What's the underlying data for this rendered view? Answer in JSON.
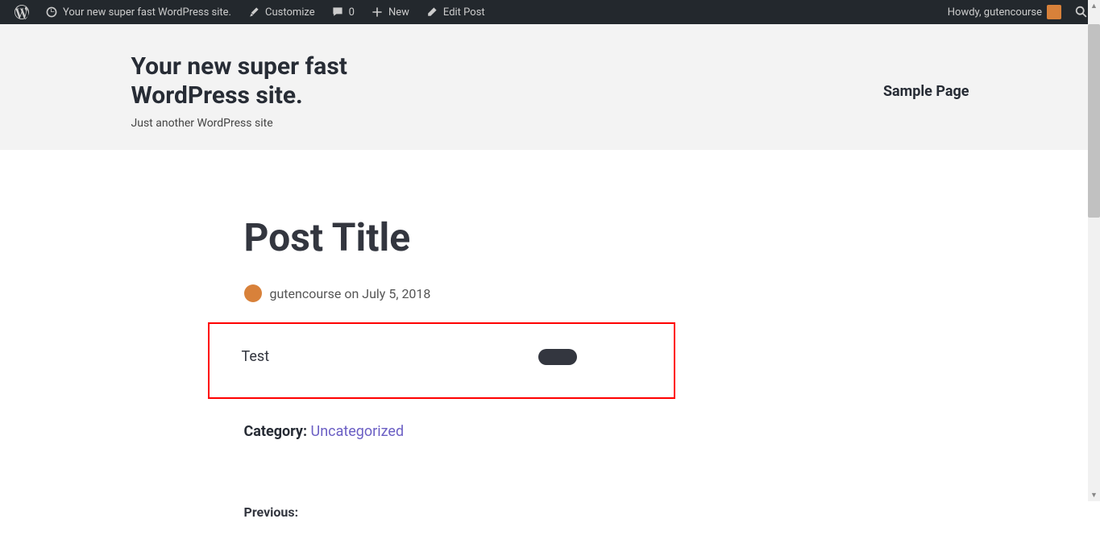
{
  "adminbar": {
    "site_name": "Your new super fast WordPress site.",
    "customize": "Customize",
    "comments_count": "0",
    "new": "New",
    "edit_post": "Edit Post",
    "howdy": "Howdy, gutencourse"
  },
  "header": {
    "title": "Your new super fast WordPress site.",
    "tagline": "Just another WordPress site",
    "nav_item": "Sample Page"
  },
  "post": {
    "title": "Post Title",
    "author": "gutencourse",
    "on": "on",
    "date": "July 5, 2018",
    "content_text": "Test",
    "category_label": "Category:",
    "category_value": "Uncategorized",
    "previous_label": "Previous:"
  }
}
